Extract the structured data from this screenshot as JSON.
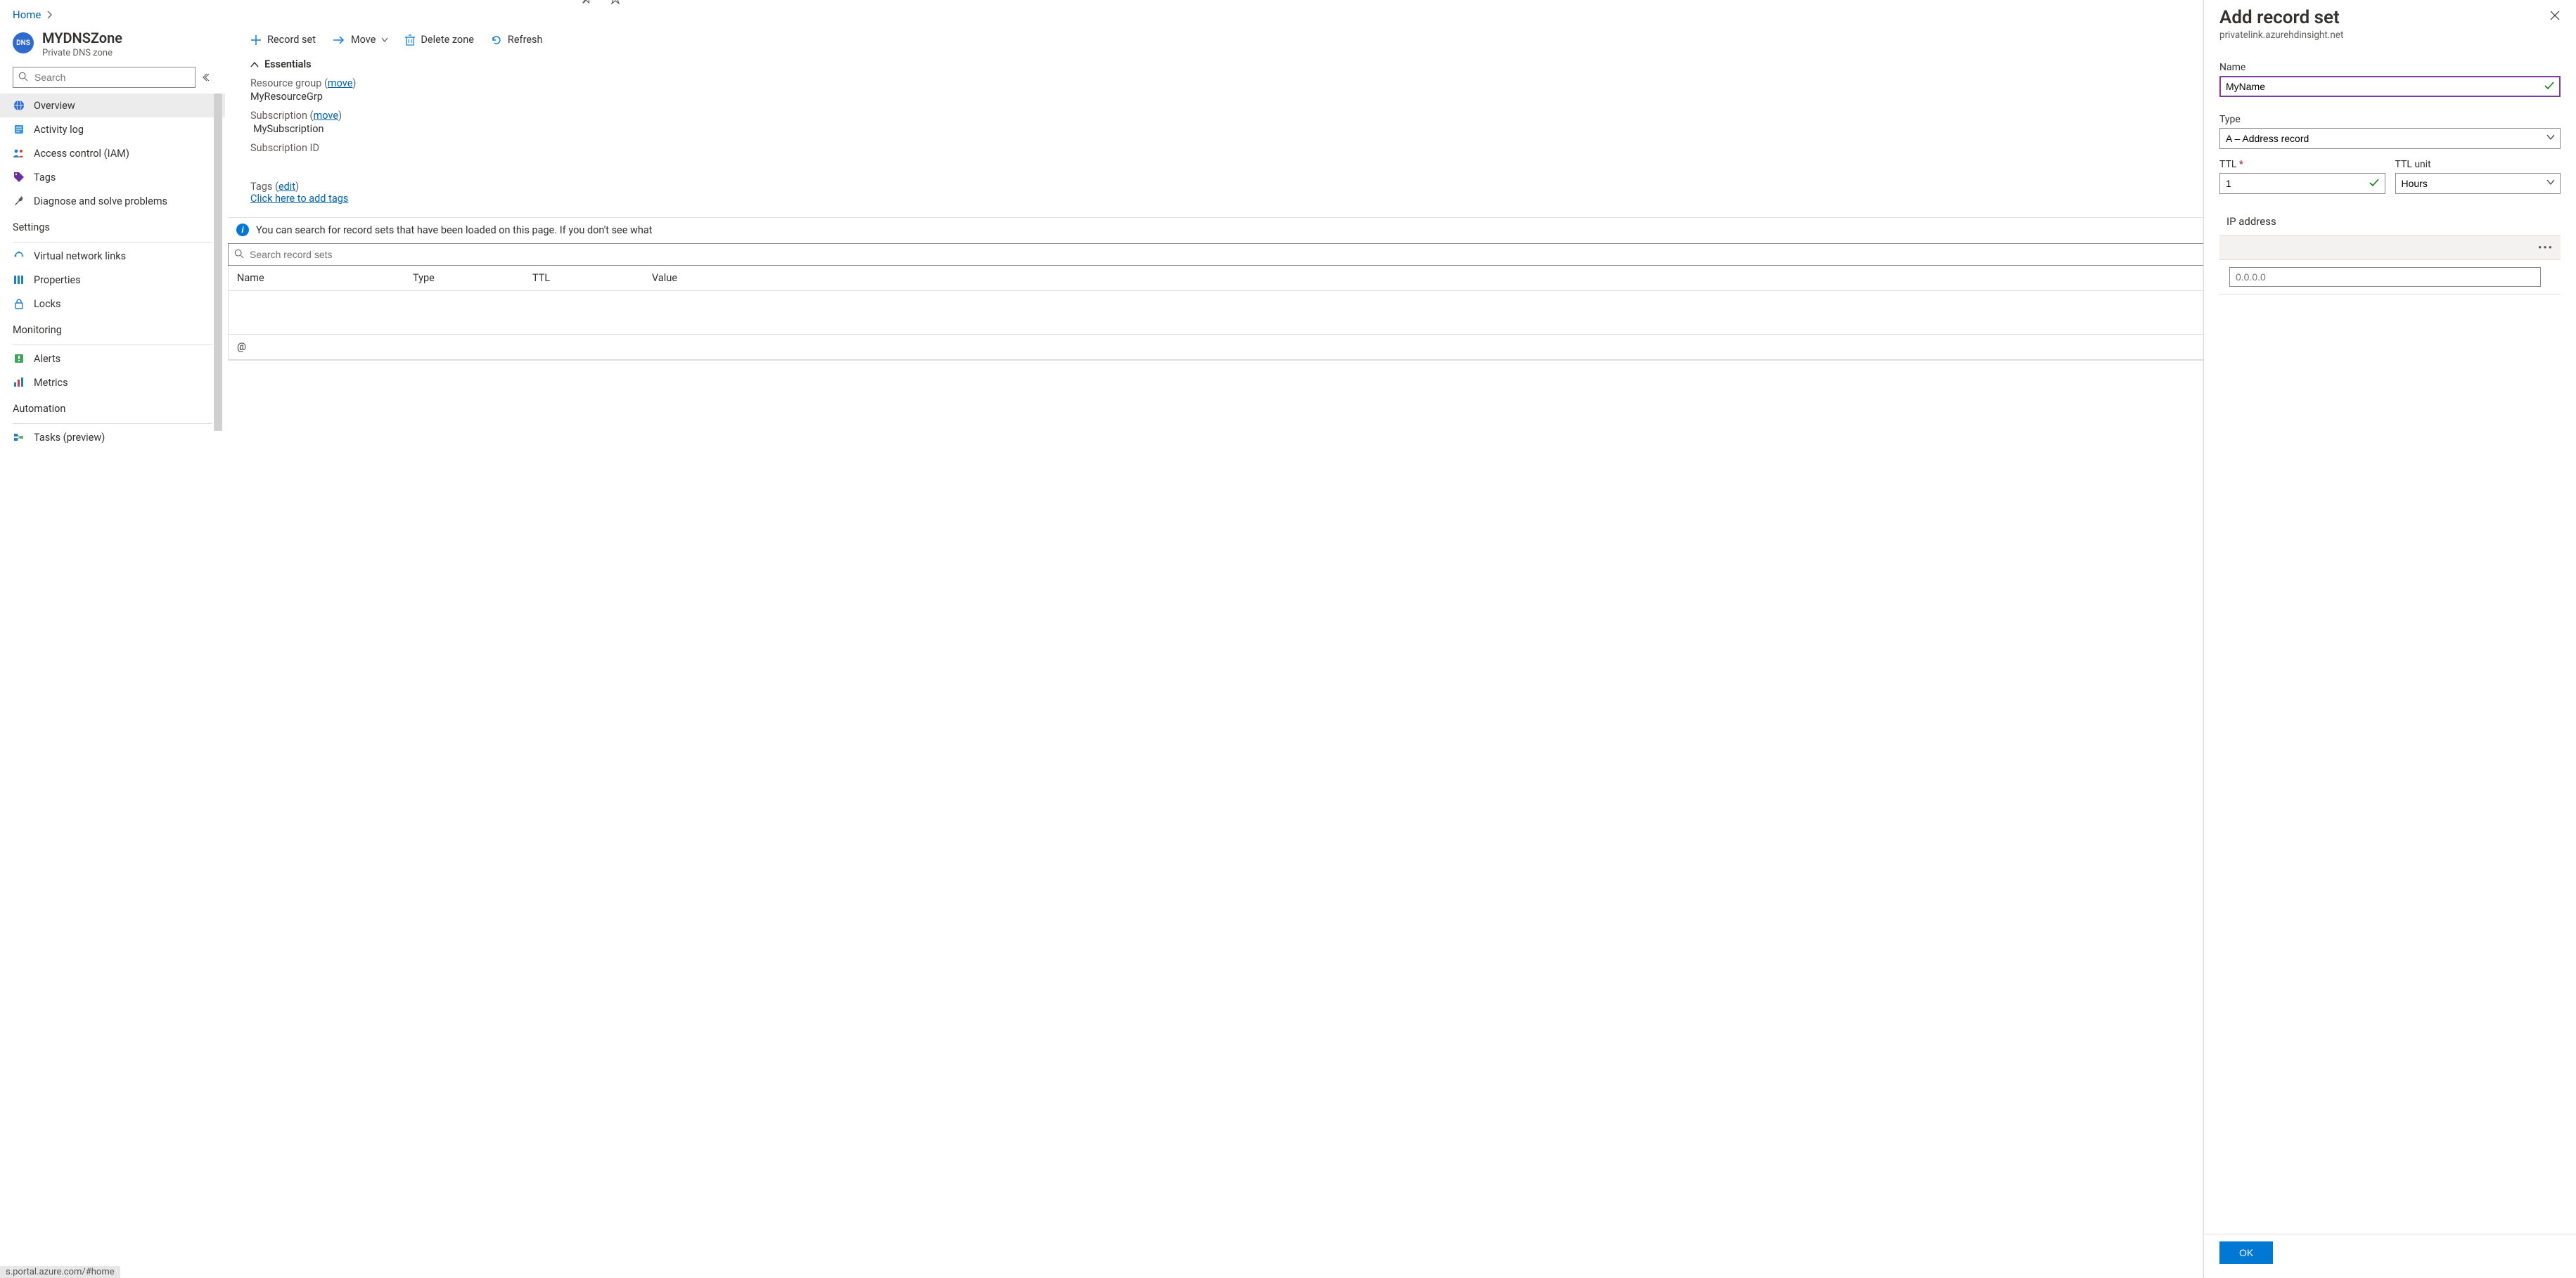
{
  "breadcrumb": {
    "home": "Home"
  },
  "resource": {
    "title": "MYDNSZone",
    "subtitle": "Private DNS zone",
    "badge": "DNS"
  },
  "search": {
    "placeholder": "Search"
  },
  "nav": {
    "items": [
      {
        "label": "Overview"
      },
      {
        "label": "Activity log"
      },
      {
        "label": "Access control (IAM)"
      },
      {
        "label": "Tags"
      },
      {
        "label": "Diagnose and solve problems"
      }
    ],
    "settings_heading": "Settings",
    "settings_items": [
      {
        "label": "Virtual network links"
      },
      {
        "label": "Properties"
      },
      {
        "label": "Locks"
      }
    ],
    "monitoring_heading": "Monitoring",
    "monitoring_items": [
      {
        "label": "Alerts"
      },
      {
        "label": "Metrics"
      }
    ],
    "automation_heading": "Automation",
    "automation_items": [
      {
        "label": "Tasks (preview)"
      }
    ]
  },
  "toolbar": {
    "record_set": "Record set",
    "move": "Move",
    "delete_zone": "Delete zone",
    "refresh": "Refresh"
  },
  "essentials": {
    "heading": "Essentials",
    "rg_label_pre": "Resource group (",
    "rg_move": "move",
    "rg_label_post": ")",
    "rg_value": "MyResourceGrp",
    "sub_label_pre": "Subscription (",
    "sub_move": "move",
    "sub_label_post": ")",
    "sub_value": "MySubscription",
    "subid_label": "Subscription ID",
    "tags_label_pre": "Tags (",
    "tags_edit": "edit",
    "tags_label_post": ")",
    "tags_link": "Click here to add tags"
  },
  "info": {
    "text": "You can search for record sets that have been loaded on this page. If you don't see what"
  },
  "record_search": {
    "placeholder": "Search record sets"
  },
  "table": {
    "headers": {
      "name": "Name",
      "type": "Type",
      "ttl": "TTL",
      "value": "Value"
    },
    "rows": [
      {
        "name": "@"
      }
    ]
  },
  "blade": {
    "title": "Add record set",
    "subtitle": "privatelink.azurehdinsight.net",
    "name_label": "Name",
    "name_value": "MyName",
    "type_label": "Type",
    "type_value": "A – Address record",
    "ttl_label": "TTL",
    "ttl_value": "1",
    "ttl_unit_label": "TTL unit",
    "ttl_unit_value": "Hours",
    "ip_label": "IP address",
    "ip_placeholder": "0.0.0.0",
    "ok": "OK"
  },
  "status_url": "s.portal.azure.com/#home"
}
